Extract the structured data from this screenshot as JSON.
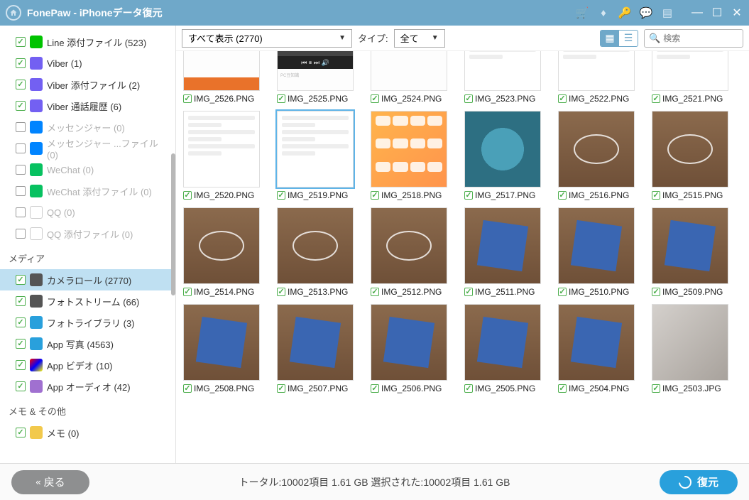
{
  "app": {
    "title": "FonePaw - iPhoneデータ復元"
  },
  "sidebar": {
    "groups": [
      {
        "items": [
          {
            "icon": "cat-line",
            "label": "Line 添付ファイル (523)",
            "checked": true,
            "active": false
          },
          {
            "icon": "cat-viber",
            "label": "Viber (1)",
            "checked": true,
            "active": false
          },
          {
            "icon": "cat-viber",
            "label": "Viber 添付ファイル (2)",
            "checked": true,
            "active": false
          },
          {
            "icon": "cat-viber",
            "label": "Viber 通話履歴 (6)",
            "checked": true,
            "active": false
          },
          {
            "icon": "cat-messenger",
            "label": "メッセンジャー (0)",
            "checked": false,
            "active": false,
            "disabled": true
          },
          {
            "icon": "cat-messenger",
            "label": "メッセンジャー ...ファイル (0)",
            "checked": false,
            "active": false,
            "disabled": true
          },
          {
            "icon": "cat-wechat",
            "label": "WeChat (0)",
            "checked": false,
            "active": false,
            "disabled": true
          },
          {
            "icon": "cat-wechat",
            "label": "WeChat 添付ファイル (0)",
            "checked": false,
            "active": false,
            "disabled": true
          },
          {
            "icon": "cat-qq",
            "label": "QQ (0)",
            "checked": false,
            "active": false,
            "disabled": true
          },
          {
            "icon": "cat-qq",
            "label": "QQ 添付ファイル (0)",
            "checked": false,
            "active": false,
            "disabled": true
          }
        ]
      },
      {
        "head": "メディア",
        "items": [
          {
            "icon": "cat-camera",
            "label": "カメラロール (2770)",
            "checked": true,
            "active": true
          },
          {
            "icon": "cat-camera",
            "label": "フォトストリーム (66)",
            "checked": true,
            "active": false
          },
          {
            "icon": "cat-lib",
            "label": "フォトライブラリ (3)",
            "checked": true,
            "active": false
          },
          {
            "icon": "cat-app",
            "label": "App 写真 (4563)",
            "checked": true,
            "active": false
          },
          {
            "icon": "cat-video",
            "label": "App ビデオ (10)",
            "checked": true,
            "active": false
          },
          {
            "icon": "cat-audio",
            "label": "App オーディオ (42)",
            "checked": true,
            "active": false
          }
        ]
      },
      {
        "head": "メモ & その他",
        "items": [
          {
            "icon": "cat-memo",
            "label": "メモ (0)",
            "checked": true,
            "active": false
          }
        ]
      }
    ]
  },
  "toolbar": {
    "filter_label": "すべて表示 (2770)",
    "type_prefix": "タイプ:",
    "type_value": "全て",
    "search_placeholder": "検索"
  },
  "grid": {
    "rows": [
      [
        {
          "file": "IMG_2526.PNG",
          "kind": "orange-text"
        },
        {
          "file": "IMG_2525.PNG",
          "kind": "player"
        },
        {
          "file": "IMG_2524.PNG",
          "kind": "text"
        },
        {
          "file": "IMG_2523.PNG",
          "kind": "settings"
        },
        {
          "file": "IMG_2522.PNG",
          "kind": "settings"
        },
        {
          "file": "IMG_2521.PNG",
          "kind": "settings"
        }
      ],
      [
        {
          "file": "IMG_2520.PNG",
          "kind": "settings"
        },
        {
          "file": "IMG_2519.PNG",
          "kind": "settings",
          "selected": true
        },
        {
          "file": "IMG_2518.PNG",
          "kind": "iphone"
        },
        {
          "file": "IMG_2517.PNG",
          "kind": "teal"
        },
        {
          "file": "IMG_2516.PNG",
          "kind": "brown"
        },
        {
          "file": "IMG_2515.PNG",
          "kind": "brown"
        }
      ],
      [
        {
          "file": "IMG_2514.PNG",
          "kind": "brown"
        },
        {
          "file": "IMG_2513.PNG",
          "kind": "brown"
        },
        {
          "file": "IMG_2512.PNG",
          "kind": "brown"
        },
        {
          "file": "IMG_2511.PNG",
          "kind": "bluecloth"
        },
        {
          "file": "IMG_2510.PNG",
          "kind": "bluecloth"
        },
        {
          "file": "IMG_2509.PNG",
          "kind": "bluecloth"
        }
      ],
      [
        {
          "file": "IMG_2508.PNG",
          "kind": "bluecloth"
        },
        {
          "file": "IMG_2507.PNG",
          "kind": "bluecloth"
        },
        {
          "file": "IMG_2506.PNG",
          "kind": "bluecloth"
        },
        {
          "file": "IMG_2505.PNG",
          "kind": "bluecloth"
        },
        {
          "file": "IMG_2504.PNG",
          "kind": "bluecloth"
        },
        {
          "file": "IMG_2503.JPG",
          "kind": "gray"
        }
      ]
    ]
  },
  "footer": {
    "back_label": "戻る",
    "status": "トータル:10002項目 1.61 GB   選択された:10002項目 1.61 GB",
    "recover_label": "復元"
  }
}
